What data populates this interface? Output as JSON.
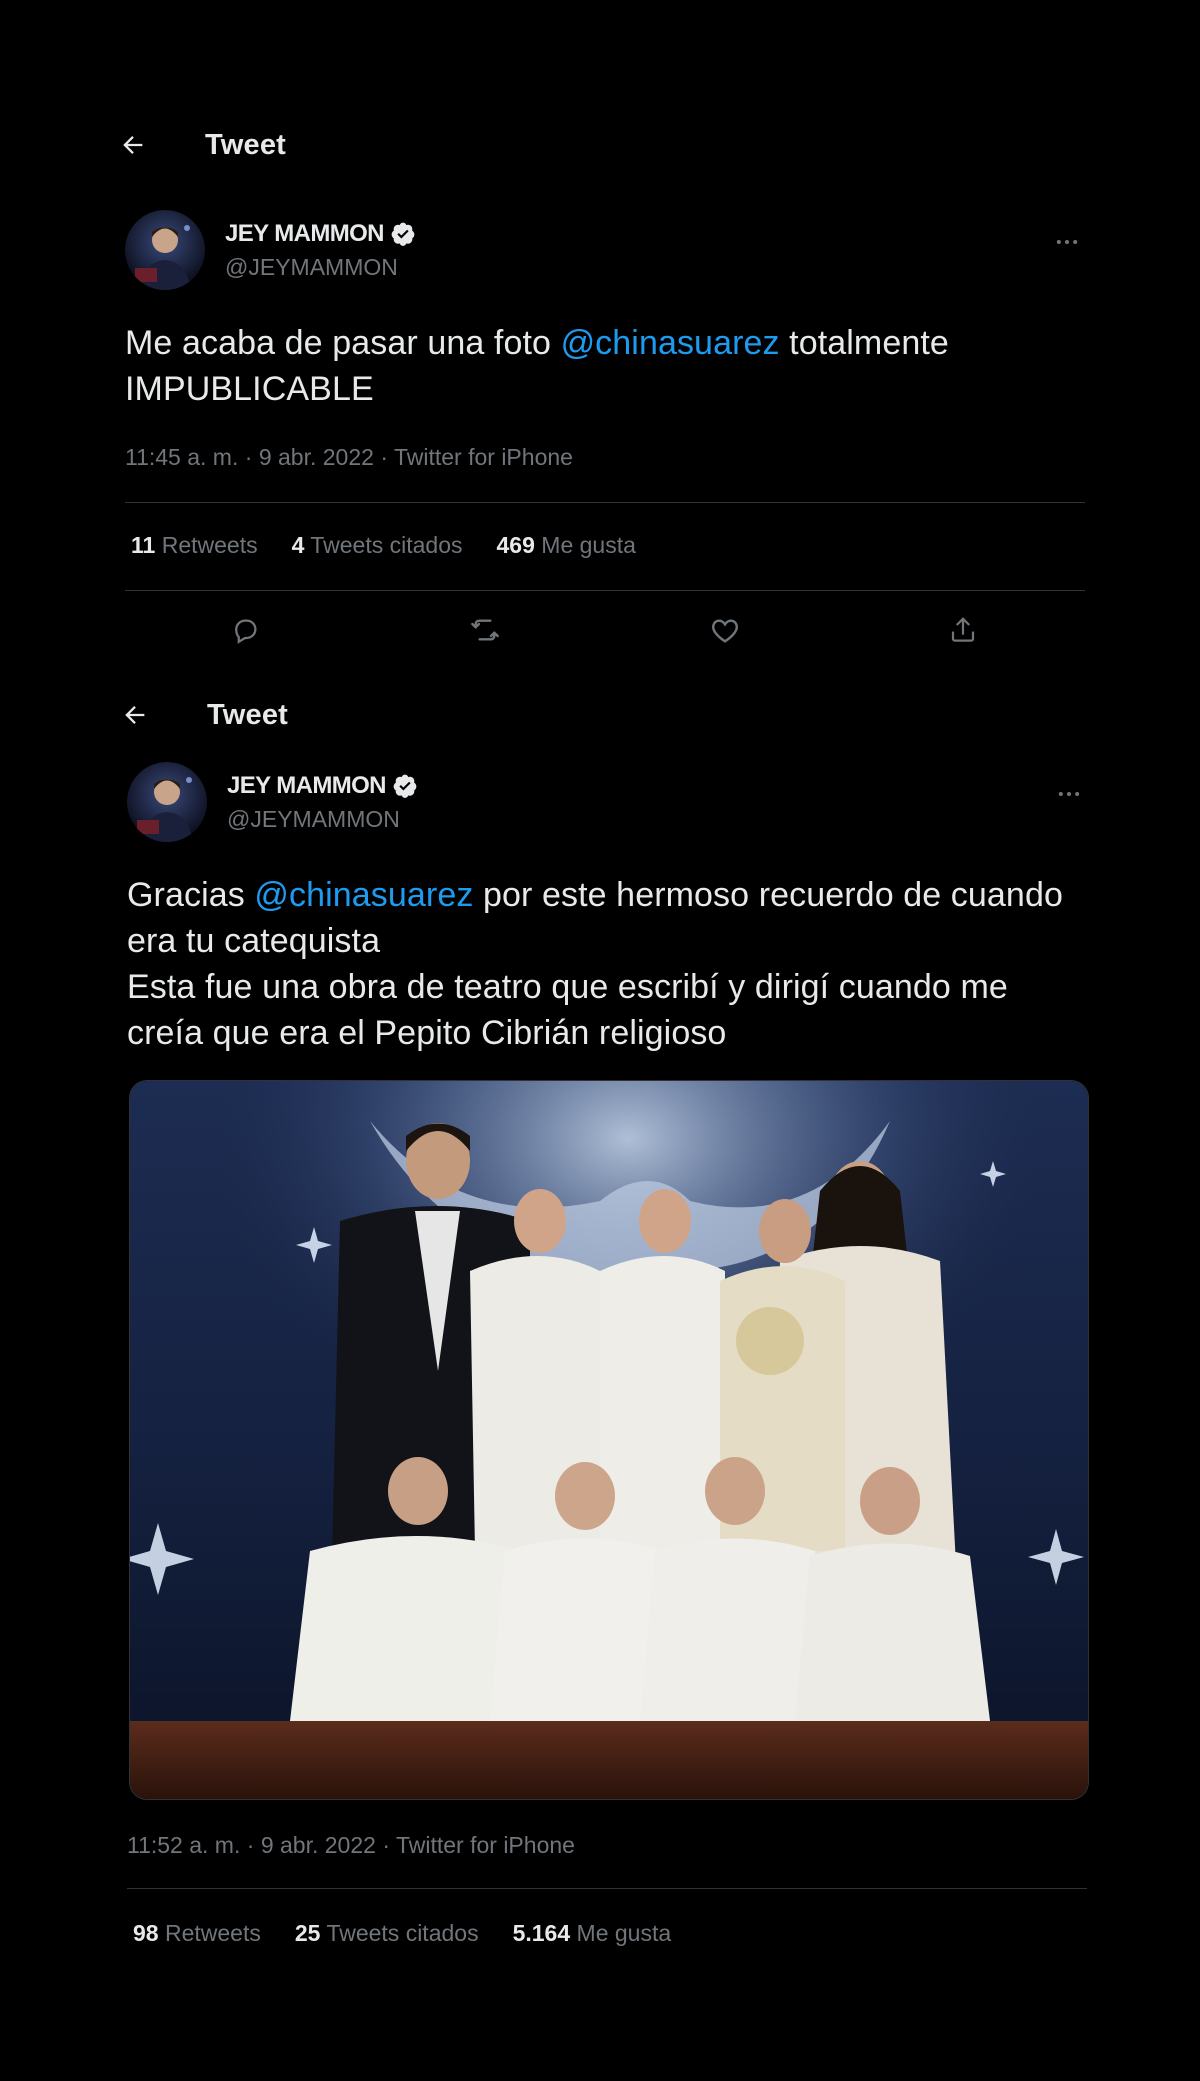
{
  "colors": {
    "background": "#000000",
    "text": "#e7e9ea",
    "secondary": "#71767b",
    "link": "#1d9bf0",
    "divider": "#2f3336"
  },
  "tweet1": {
    "header": {
      "title": "Tweet",
      "back_icon": "arrow-left-icon"
    },
    "author": {
      "name": "JEY MAMMON",
      "handle": "@JEYMAMMON",
      "verified_icon": "verified-badge-icon"
    },
    "text": {
      "part1": "Me acaba de pasar una foto ",
      "mention": "@chinasuarez",
      "part2": " totalmente IMPUBLICABLE"
    },
    "meta": {
      "time": "11:45 a. m.",
      "sep": " · ",
      "date": "9 abr. 2022",
      "source": "Twitter for iPhone"
    },
    "stats": {
      "retweets_count": "11",
      "retweets_label": "Retweets",
      "quotes_count": "4",
      "quotes_label": "Tweets citados",
      "likes_count": "469",
      "likes_label": "Me gusta"
    },
    "actions": [
      "reply-icon",
      "retweet-icon",
      "like-icon",
      "share-icon"
    ]
  },
  "tweet2": {
    "header": {
      "title": "Tweet",
      "back_icon": "arrow-left-icon"
    },
    "author": {
      "name": "JEY MAMMON",
      "handle": "@JEYMAMMON",
      "verified_icon": "verified-badge-icon"
    },
    "text": {
      "part1": "Gracias ",
      "mention": "@chinasuarez",
      "part2": " por este hermoso recuerdo de cuando era tu catequista",
      "line2": "Esta fue una obra de teatro que escribí y dirigí cuando me creía que era el Pepito Cibrián religioso"
    },
    "meta": {
      "time": "11:52 a. m.",
      "sep": " · ",
      "date": "9 abr. 2022",
      "source": "Twitter for iPhone"
    },
    "stats": {
      "retweets_count": "98",
      "retweets_label": "Retweets",
      "quotes_count": "25",
      "quotes_label": "Tweets citados",
      "likes_count": "5.164",
      "likes_label": "Me gusta"
    }
  }
}
